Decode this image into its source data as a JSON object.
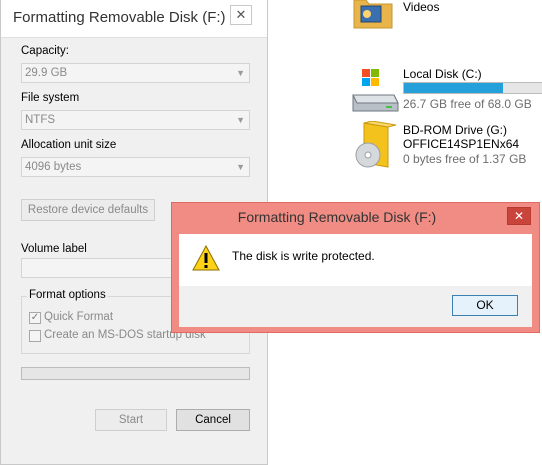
{
  "explorer": {
    "videos_label": "Videos",
    "drives": [
      {
        "name": "Local Disk (C:)",
        "free": "26.7 GB free of 68.0 GB",
        "used_fraction": 0.61
      },
      {
        "name": "BD-ROM Drive (G:)",
        "volume": "OFFICE14SP1ENx64",
        "free": "0 bytes free of 1.37 GB"
      }
    ]
  },
  "format_dialog": {
    "title": "Formatting Removable Disk (F:)",
    "close_glyph": "✕",
    "capacity_label": "Capacity:",
    "capacity_value": "29.9 GB",
    "filesystem_label": "File system",
    "filesystem_value": "NTFS",
    "allocation_label": "Allocation unit size",
    "allocation_value": "4096 bytes",
    "restore_button": "Restore device defaults",
    "volume_label_label": "Volume label",
    "volume_label_value": "",
    "format_options_label": "Format options",
    "quick_format_label": "Quick Format",
    "quick_format_checked": true,
    "msdos_label": "Create an MS-DOS startup disk",
    "msdos_checked": false,
    "progress": 0,
    "start_button": "Start",
    "cancel_button": "Cancel"
  },
  "error_dialog": {
    "title": "Formatting Removable Disk (F:)",
    "close_glyph": "✕",
    "icon": "warning-icon",
    "message": "The disk is write protected.",
    "ok_button": "OK"
  },
  "colors": {
    "error_titlebar": "#f08c84",
    "error_close": "#c9453c",
    "drive_bar_fill": "#26a0da",
    "ok_border": "#3c7fb1"
  }
}
